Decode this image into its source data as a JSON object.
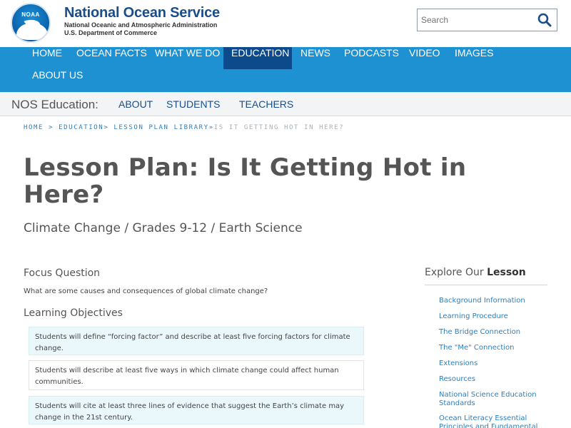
{
  "header": {
    "logo_text": "NOAA",
    "org_title": "National Ocean Service",
    "org_sub1": "National Oceanic and Atmospheric Administration",
    "org_sub2": "U.S. Department of Commerce",
    "search_placeholder": "Search",
    "search_icon": "magnifier"
  },
  "mainnav": {
    "items": [
      {
        "label": "HOME"
      },
      {
        "label": "OCEAN FACTS"
      },
      {
        "label": "WHAT WE DO"
      },
      {
        "label": "EDUCATION",
        "active": true
      },
      {
        "label": "NEWS"
      },
      {
        "label": "PODCASTS"
      },
      {
        "label": "VIDEO"
      },
      {
        "label": "IMAGES"
      },
      {
        "label": "ABOUT US"
      }
    ]
  },
  "subnav": {
    "label": "NOS Education:",
    "items": [
      {
        "label": "ABOUT"
      },
      {
        "label": "STUDENTS"
      },
      {
        "label": "TEACHERS"
      }
    ]
  },
  "breadcrumb": {
    "items": [
      "HOME",
      "EDUCATION",
      "LESSON PLAN LIBRARY"
    ],
    "current": "IS IT GETTING HOT IN HERE?"
  },
  "page": {
    "title": "Lesson Plan: Is It Getting Hot in Here?",
    "subtitle": "Climate Change / Grades 9-12 / Earth Science",
    "focus_heading": "Focus Question",
    "focus_question": "What are some causes and consequences of global climate change?",
    "objectives_heading": "Learning Objectives",
    "objectives": [
      "Students will define “forcing factor” and describe at least five forcing factors for climate change.",
      "Students will describe at least five ways in which climate change could affect human communities.",
      "Students will cite at least three lines of evidence that suggest the Earth’s climate may change in the 21st century."
    ]
  },
  "sidebar": {
    "heading_prefix": "Explore Our",
    "heading_bold": "Lesson",
    "links": [
      "Background Information",
      "Learning Procedure",
      "The Bridge Connection",
      "The \"Me\" Connection",
      "Extensions",
      "Resources",
      "National Science Education Standards",
      "Ocean Literacy Essential Principles and Fundamental"
    ]
  },
  "colors": {
    "nav_bg": "#1e91d3",
    "nav_active": "#0c4a8c",
    "brand_blue": "#1a4e8a",
    "link_blue": "#2c7fbd"
  }
}
